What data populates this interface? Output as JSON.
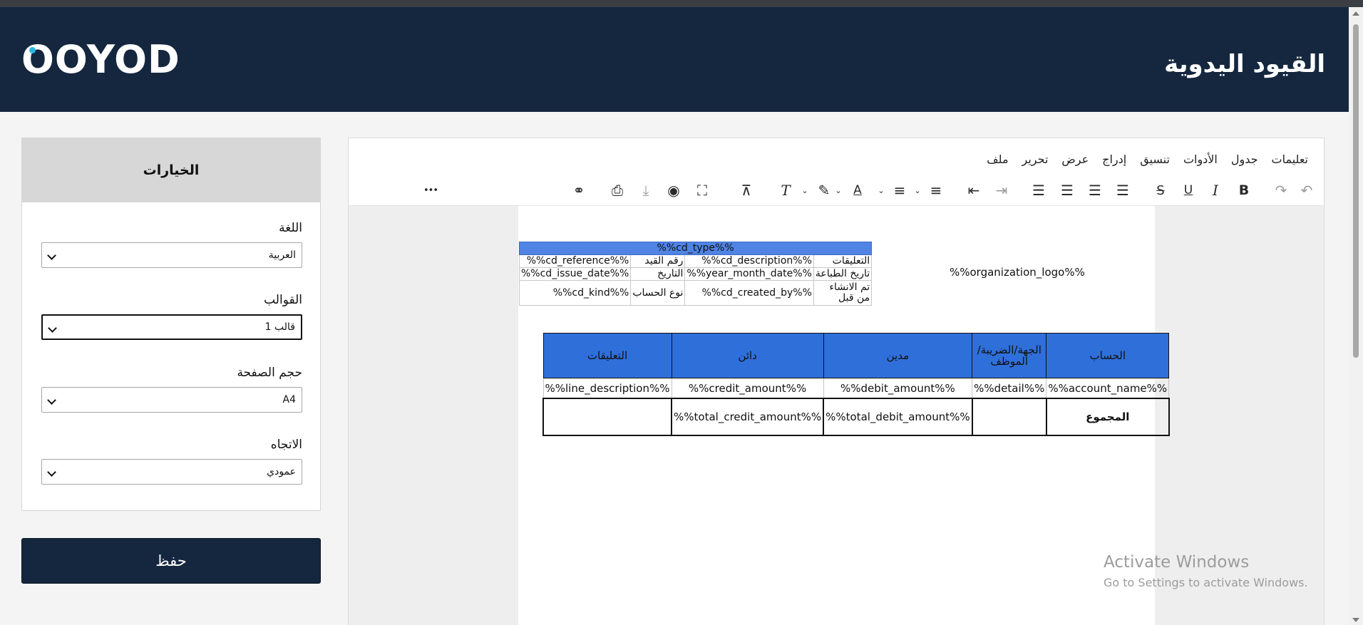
{
  "header": {
    "logo": "OOYOD",
    "page_title": "القيود اليدوية"
  },
  "options_panel": {
    "title": "الخيارات",
    "language": {
      "label": "اللغة",
      "value": "العربية"
    },
    "templates": {
      "label": "القوالب",
      "value": "قالب 1"
    },
    "page_size": {
      "label": "حجم الصفحة",
      "value": "A4"
    },
    "orientation": {
      "label": "الاتجاه",
      "value": "عمودي"
    },
    "save_label": "حفظ"
  },
  "editor": {
    "menu": [
      "ملف",
      "تحرير",
      "عرض",
      "إدراج",
      "تنسيق",
      "الأدوات",
      "جدول",
      "تعليمات"
    ],
    "toolbar_icons": [
      "undo-icon",
      "redo-icon",
      "bold-icon",
      "italic-icon",
      "underline-icon",
      "strikethrough-icon",
      "align-left-icon",
      "align-center-icon",
      "align-right-icon",
      "align-justify-icon",
      "indent-icon",
      "outdent-icon",
      "numbered-list-icon",
      "bulleted-list-icon",
      "text-color-icon",
      "highlight-icon",
      "clear-formatting-icon",
      "page-break-icon",
      "fullscreen-icon",
      "preview-icon",
      "download-icon",
      "print-icon",
      "link-icon",
      "more-icon"
    ],
    "toolbar_glyphs": {
      "bold": "B",
      "italic": "I",
      "underline": "U",
      "strike": "S",
      "color": "A",
      "more": "•••"
    }
  },
  "document": {
    "org_logo": "%%organization_logo%%",
    "cd_type": "%%cd_type%%",
    "info_rows": [
      [
        "التعليقات",
        "%%cd_description%%",
        "رقم القيد",
        "%%cd_reference%%"
      ],
      [
        "تاريخ الطباعة",
        "%%year_month_date%%",
        "التاريخ",
        "%%cd_issue_date%%"
      ],
      [
        "تم الانشاء من قبل",
        "%%cd_created_by%%",
        "نوع الحساب",
        "%%cd_kind%%"
      ]
    ],
    "lines_header": [
      "الحساب",
      "الجهة/الضريبة/الموظف",
      "مدين",
      "دائن",
      "التعليقات"
    ],
    "lines_row": [
      "%%account_name%%",
      "%%detail%%",
      "%%debit_amount%%",
      "%%credit_amount%%",
      "%%line_description%%"
    ],
    "total_row": [
      "المجموع",
      "",
      "%%total_debit_amount%%",
      "%%total_credit_amount%%",
      ""
    ]
  },
  "watermark": {
    "line1": "Activate Windows",
    "line2": "Go to Settings to activate Windows."
  }
}
